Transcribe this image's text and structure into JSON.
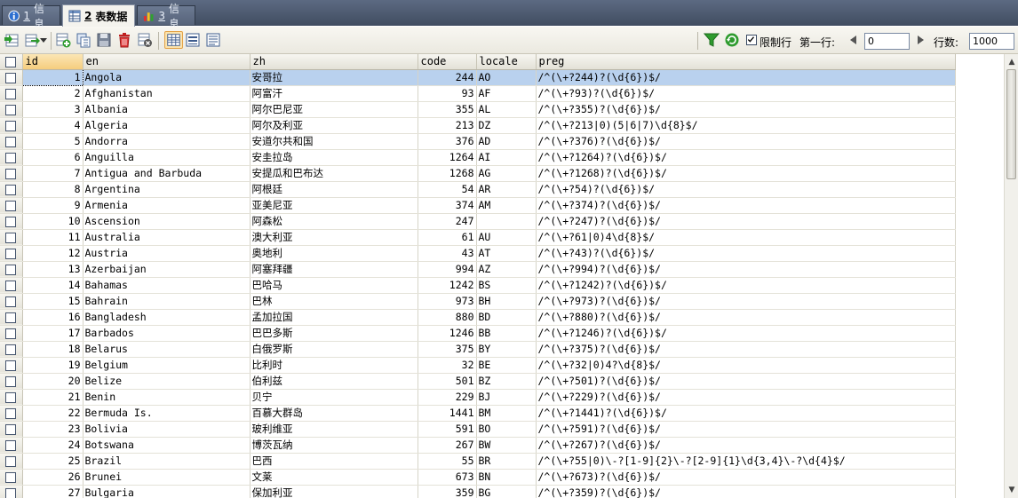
{
  "tabs": [
    {
      "num": "1",
      "label": "信息",
      "active": false
    },
    {
      "num": "2",
      "label": "表数据",
      "active": true
    },
    {
      "num": "3",
      "label": "信息",
      "active": false
    }
  ],
  "toolbar": {
    "limit_rows_label": "限制行",
    "limit_rows_checked": true,
    "first_row_label": "第一行:",
    "first_row_value": "0",
    "rows_label": "行数:",
    "rows_value": "1000"
  },
  "icons": [
    "insert-row-icon",
    "export-icon",
    "add-row-icon",
    "duplicate-icon",
    "save-icon",
    "delete-icon",
    "cancel-icon",
    "grid-view-icon",
    "form-view-icon",
    "text-view-icon",
    "filter-icon",
    "refresh-icon",
    "prev-page-icon",
    "next-page-icon"
  ],
  "colors": {
    "selected_row": "#b9d1ee",
    "sorted_header": "#f5cd7e",
    "tab_bar": "#4a566c"
  },
  "table": {
    "columns": [
      "id",
      "en",
      "zh",
      "code",
      "locale",
      "preg"
    ],
    "rows": [
      [
        "1",
        "Angola",
        "安哥拉",
        "244",
        "AO",
        "/^(\\+?244)?(\\d{6})$/"
      ],
      [
        "2",
        "Afghanistan",
        "阿富汗",
        "93",
        "AF",
        "/^(\\+?93)?(\\d{6})$/"
      ],
      [
        "3",
        "Albania",
        "阿尔巴尼亚",
        "355",
        "AL",
        "/^(\\+?355)?(\\d{6})$/"
      ],
      [
        "4",
        "Algeria",
        "阿尔及利亚",
        "213",
        "DZ",
        "/^(\\+?213|0)(5|6|7)\\d{8}$/"
      ],
      [
        "5",
        "Andorra",
        "安道尔共和国",
        "376",
        "AD",
        "/^(\\+?376)?(\\d{6})$/"
      ],
      [
        "6",
        "Anguilla",
        "安圭拉岛",
        "1264",
        "AI",
        "/^(\\+?1264)?(\\d{6})$/"
      ],
      [
        "7",
        "Antigua and Barbuda",
        "安提瓜和巴布达",
        "1268",
        "AG",
        "/^(\\+?1268)?(\\d{6})$/"
      ],
      [
        "8",
        "Argentina",
        "阿根廷",
        "54",
        "AR",
        "/^(\\+?54)?(\\d{6})$/"
      ],
      [
        "9",
        "Armenia",
        "亚美尼亚",
        "374",
        "AM",
        "/^(\\+?374)?(\\d{6})$/"
      ],
      [
        "10",
        "Ascension",
        "阿森松",
        "247",
        "",
        "/^(\\+?247)?(\\d{6})$/"
      ],
      [
        "11",
        "Australia",
        "澳大利亚",
        "61",
        "AU",
        "/^(\\+?61|0)4\\d{8}$/"
      ],
      [
        "12",
        "Austria",
        "奥地利",
        "43",
        "AT",
        "/^(\\+?43)?(\\d{6})$/"
      ],
      [
        "13",
        "Azerbaijan",
        "阿塞拜疆",
        "994",
        "AZ",
        "/^(\\+?994)?(\\d{6})$/"
      ],
      [
        "14",
        "Bahamas",
        "巴哈马",
        "1242",
        "BS",
        "/^(\\+?1242)?(\\d{6})$/"
      ],
      [
        "15",
        "Bahrain",
        "巴林",
        "973",
        "BH",
        "/^(\\+?973)?(\\d{6})$/"
      ],
      [
        "16",
        "Bangladesh",
        "孟加拉国",
        "880",
        "BD",
        "/^(\\+?880)?(\\d{6})$/"
      ],
      [
        "17",
        "Barbados",
        "巴巴多斯",
        "1246",
        "BB",
        "/^(\\+?1246)?(\\d{6})$/"
      ],
      [
        "18",
        "Belarus",
        "白俄罗斯",
        "375",
        "BY",
        "/^(\\+?375)?(\\d{6})$/"
      ],
      [
        "19",
        "Belgium",
        "比利时",
        "32",
        "BE",
        "/^(\\+?32|0)4?\\d{8}$/"
      ],
      [
        "20",
        "Belize",
        "伯利兹",
        "501",
        "BZ",
        "/^(\\+?501)?(\\d{6})$/"
      ],
      [
        "21",
        "Benin",
        "贝宁",
        "229",
        "BJ",
        "/^(\\+?229)?(\\d{6})$/"
      ],
      [
        "22",
        "Bermuda Is.",
        "百慕大群岛",
        "1441",
        "BM",
        "/^(\\+?1441)?(\\d{6})$/"
      ],
      [
        "23",
        "Bolivia",
        "玻利维亚",
        "591",
        "BO",
        "/^(\\+?591)?(\\d{6})$/"
      ],
      [
        "24",
        "Botswana",
        "博茨瓦纳",
        "267",
        "BW",
        "/^(\\+?267)?(\\d{6})$/"
      ],
      [
        "25",
        "Brazil",
        "巴西",
        "55",
        "BR",
        "/^(\\+?55|0)\\-?[1-9]{2}\\-?[2-9]{1}\\d{3,4}\\-?\\d{4}$/"
      ],
      [
        "26",
        "Brunei",
        "文莱",
        "673",
        "BN",
        "/^(\\+?673)?(\\d{6})$/"
      ],
      [
        "27",
        "Bulgaria",
        "保加利亚",
        "359",
        "BG",
        "/^(\\+?359)?(\\d{6})$/"
      ]
    ]
  }
}
